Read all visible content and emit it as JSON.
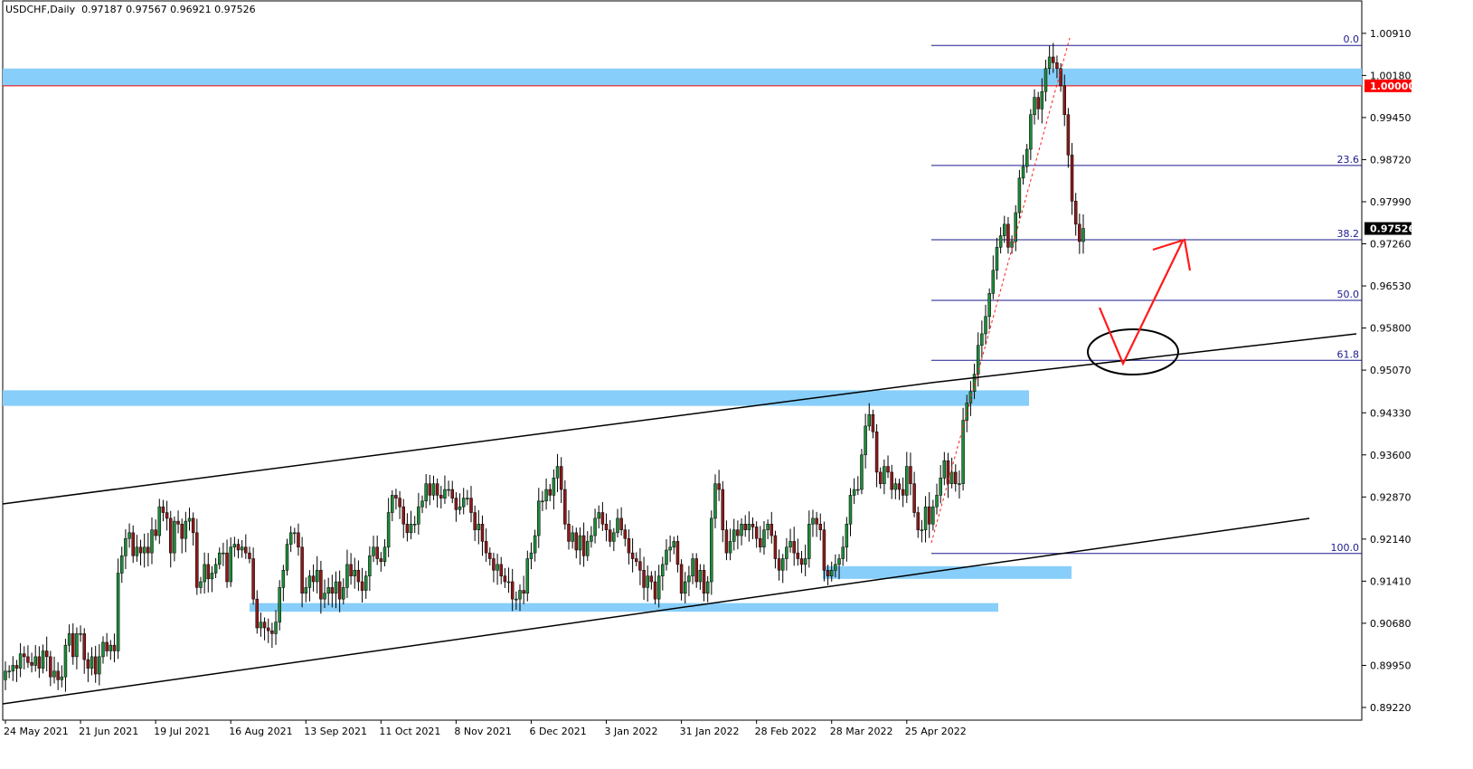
{
  "header": {
    "symbol": "USDCHF,Daily",
    "ohlc": "0.97187 0.97567 0.96921 0.97526"
  },
  "colors": {
    "bull": "#1f8a3a",
    "bear": "#8b1a1a",
    "zone": "#87cefa",
    "fib": "#1a1a8c",
    "trend": "#000000",
    "annot": "#ff1a1a",
    "parity": "#ff0000"
  },
  "chart_data": {
    "type": "candlestick",
    "symbol": "USDCHF",
    "timeframe": "Daily",
    "ylim": [
      0.89,
      1.013
    ],
    "y_ticks": [
      "1.00910",
      "1.00180",
      "0.99450",
      "0.98720",
      "0.97990",
      "0.97260",
      "0.96530",
      "0.95800",
      "0.95070",
      "0.94330",
      "0.93600",
      "0.92870",
      "0.92140",
      "0.91410",
      "0.90680",
      "0.89950",
      "0.89220"
    ],
    "x_ticks": [
      "24 May 2021",
      "21 Jun 2021",
      "19 Jul 2021",
      "16 Aug 2021",
      "13 Sep 2021",
      "11 Oct 2021",
      "8 Nov 2021",
      "6 Dec 2021",
      "3 Jan 2022",
      "31 Jan 2022",
      "28 Feb 2022",
      "28 Mar 2022",
      "25 Apr 2022"
    ],
    "last_price": "0.97526",
    "parity_label": "1.00000",
    "fib_levels": [
      {
        "label": "0.0",
        "price": 1.007
      },
      {
        "label": "23.6",
        "price": 0.9862
      },
      {
        "label": "38.2",
        "price": 0.9733
      },
      {
        "label": "50.0",
        "price": 0.9628
      },
      {
        "label": "61.8",
        "price": 0.9524
      },
      {
        "label": "100.0",
        "price": 0.9189
      }
    ],
    "closes": [
      0.8985,
      0.8985,
      0.8995,
      0.899,
      0.9015,
      0.901,
      0.9,
      0.8995,
      0.901,
      0.899,
      0.902,
      0.901,
      0.8975,
      0.8985,
      0.897,
      0.8975,
      0.903,
      0.905,
      0.901,
      0.905,
      0.905,
      0.9005,
      0.899,
      0.901,
      0.898,
      0.901,
      0.9035,
      0.902,
      0.903,
      0.902,
      0.9155,
      0.9185,
      0.9215,
      0.9225,
      0.9185,
      0.92,
      0.919,
      0.92,
      0.919,
      0.923,
      0.922,
      0.927,
      0.926,
      0.925,
      0.919,
      0.9245,
      0.924,
      0.9215,
      0.9245,
      0.925,
      0.9225,
      0.913,
      0.914,
      0.917,
      0.9145,
      0.9155,
      0.917,
      0.919,
      0.919,
      0.914,
      0.92,
      0.9205,
      0.9195,
      0.92,
      0.919,
      0.918,
      0.911,
      0.906,
      0.907,
      0.906,
      0.9055,
      0.905,
      0.907,
      0.913,
      0.916,
      0.9205,
      0.9225,
      0.9225,
      0.92,
      0.912,
      0.913,
      0.915,
      0.914,
      0.916,
      0.911,
      0.912,
      0.913,
      0.912,
      0.914,
      0.911,
      0.913,
      0.917,
      0.915,
      0.916,
      0.914,
      0.9125,
      0.915,
      0.9185,
      0.92,
      0.918,
      0.9175,
      0.92,
      0.926,
      0.929,
      0.9285,
      0.927,
      0.924,
      0.9225,
      0.924,
      0.924,
      0.927,
      0.928,
      0.931,
      0.929,
      0.931,
      0.929,
      0.9285,
      0.93,
      0.93,
      0.9285,
      0.9265,
      0.927,
      0.9285,
      0.9285,
      0.926,
      0.923,
      0.924,
      0.921,
      0.919,
      0.918,
      0.916,
      0.917,
      0.915,
      0.914,
      0.914,
      0.911,
      0.911,
      0.9125,
      0.912,
      0.918,
      0.919,
      0.922,
      0.928,
      0.928,
      0.93,
      0.929,
      0.932,
      0.934,
      0.93,
      0.924,
      0.921,
      0.9225,
      0.9195,
      0.922,
      0.9185,
      0.921,
      0.922,
      0.925,
      0.926,
      0.924,
      0.923,
      0.921,
      0.9225,
      0.925,
      0.923,
      0.9215,
      0.919,
      0.918,
      0.9175,
      0.916,
      0.913,
      0.915,
      0.914,
      0.911,
      0.915,
      0.917,
      0.9195,
      0.92,
      0.921,
      0.917,
      0.912,
      0.914,
      0.915,
      0.918,
      0.914,
      0.916,
      0.912,
      0.914,
      0.925,
      0.931,
      0.93,
      0.923,
      0.919,
      0.921,
      0.923,
      0.922,
      0.924,
      0.923,
      0.924,
      0.9235,
      0.9215,
      0.92,
      0.923,
      0.924,
      0.922,
      0.918,
      0.916,
      0.918,
      0.92,
      0.921,
      0.919,
      0.918,
      0.917,
      0.918,
      0.924,
      0.925,
      0.924,
      0.923,
      0.916,
      0.915,
      0.916,
      0.917,
      0.918,
      0.92,
      0.924,
      0.929,
      0.93,
      0.93,
      0.936,
      0.941,
      0.943,
      0.94,
      0.933,
      0.931,
      0.934,
      0.933,
      0.93,
      0.931,
      0.93,
      0.929,
      0.934,
      0.931,
      0.926,
      0.923,
      0.923,
      0.927,
      0.924,
      0.927,
      0.929,
      0.932,
      0.935,
      0.931,
      0.933,
      0.931,
      0.931,
      0.942,
      0.945,
      0.947,
      0.95,
      0.955,
      0.957,
      0.96,
      0.964,
      0.968,
      0.972,
      0.974,
      0.976,
      0.972,
      0.973,
      0.978,
      0.984,
      0.986,
      0.989,
      0.995,
      0.998,
      0.996,
      0.999,
      1.003,
      1.005,
      1.004,
      1.003,
      1.0,
      0.995,
      0.988,
      0.98,
      0.976,
      0.973,
      0.97526
    ]
  },
  "annotations": {
    "zones": 4,
    "channel": "ascending",
    "arrow": "red down-then-up arrow with ellipse at 61.8"
  }
}
